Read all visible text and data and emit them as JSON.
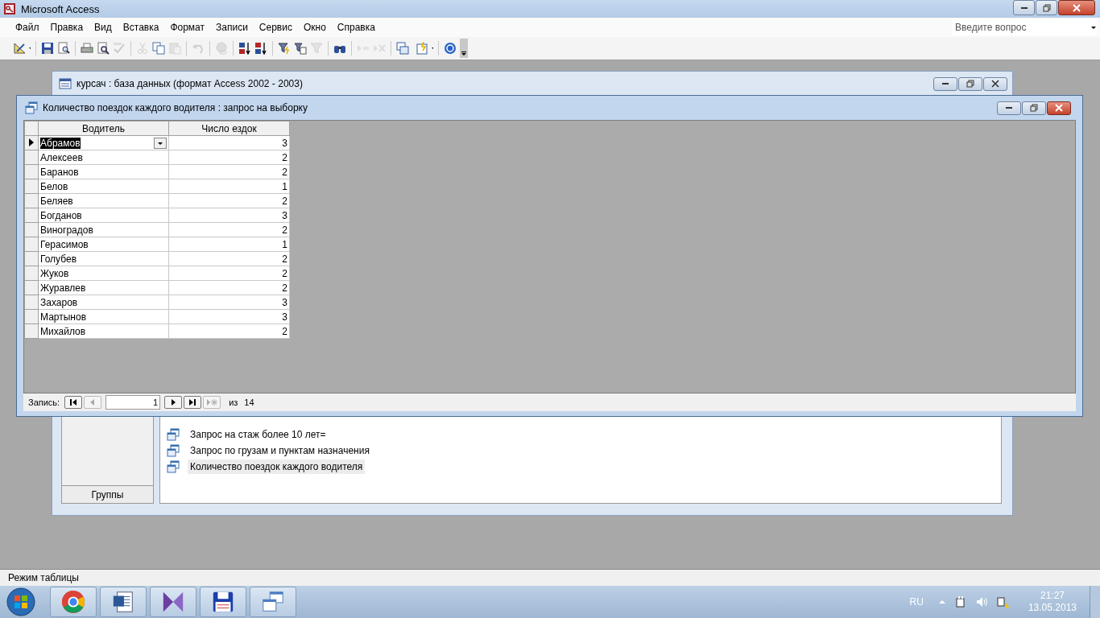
{
  "app": {
    "title": "Microsoft Access",
    "help_search": {
      "placeholder": "Введите вопрос"
    }
  },
  "menu": [
    "Файл",
    "Правка",
    "Вид",
    "Вставка",
    "Формат",
    "Записи",
    "Сервис",
    "Окно",
    "Справка"
  ],
  "toolbar": [
    {
      "kind": "design",
      "disabled": false
    },
    {
      "kind": "separator"
    },
    {
      "kind": "save",
      "disabled": false
    },
    {
      "kind": "file-search",
      "disabled": false
    },
    {
      "kind": "separator"
    },
    {
      "kind": "print",
      "disabled": false
    },
    {
      "kind": "preview",
      "disabled": false
    },
    {
      "kind": "spelling",
      "disabled": true
    },
    {
      "kind": "separator"
    },
    {
      "kind": "cut",
      "disabled": true
    },
    {
      "kind": "copy",
      "disabled": false
    },
    {
      "kind": "paste",
      "disabled": true
    },
    {
      "kind": "separator"
    },
    {
      "kind": "undo",
      "disabled": true
    },
    {
      "kind": "separator"
    },
    {
      "kind": "hyperlink",
      "disabled": true
    },
    {
      "kind": "separator"
    },
    {
      "kind": "sort-asc",
      "disabled": false
    },
    {
      "kind": "sort-desc",
      "disabled": false
    },
    {
      "kind": "separator"
    },
    {
      "kind": "filter-selection",
      "disabled": false
    },
    {
      "kind": "filter-form",
      "disabled": false
    },
    {
      "kind": "filter",
      "disabled": true
    },
    {
      "kind": "separator"
    },
    {
      "kind": "find",
      "disabled": false
    },
    {
      "kind": "separator"
    },
    {
      "kind": "new-record",
      "disabled": true
    },
    {
      "kind": "delete-record",
      "disabled": true
    },
    {
      "kind": "separator"
    },
    {
      "kind": "database-window",
      "disabled": false
    },
    {
      "kind": "new-object",
      "disabled": false
    },
    {
      "kind": "separator"
    },
    {
      "kind": "help",
      "disabled": false
    }
  ],
  "db_window": {
    "title": "курсач : база данных (формат Access 2002 - 2003)",
    "groups_button": "Группы",
    "objects": [
      {
        "label": "Запрос на стаж более 10 лет=",
        "selected": false
      },
      {
        "label": "Запрос по грузам и пунктам назначения",
        "selected": false
      },
      {
        "label": "Количество поездок каждого водителя",
        "selected": true
      }
    ]
  },
  "query_window": {
    "title": "Количество поездок каждого водителя : запрос на выборку",
    "columns": [
      "Водитель",
      "Число ездок"
    ],
    "rows": [
      {
        "driver": "Абрамов",
        "trips": "3",
        "current": true
      },
      {
        "driver": "Алексеев",
        "trips": "2",
        "current": false
      },
      {
        "driver": "Баранов",
        "trips": "2",
        "current": false
      },
      {
        "driver": "Белов",
        "trips": "1",
        "current": false
      },
      {
        "driver": "Беляев",
        "trips": "2",
        "current": false
      },
      {
        "driver": "Богданов",
        "trips": "3",
        "current": false
      },
      {
        "driver": "Виноградов",
        "trips": "2",
        "current": false
      },
      {
        "driver": "Герасимов",
        "trips": "1",
        "current": false
      },
      {
        "driver": "Голубев",
        "trips": "2",
        "current": false
      },
      {
        "driver": "Жуков",
        "trips": "2",
        "current": false
      },
      {
        "driver": "Журавлев",
        "trips": "2",
        "current": false
      },
      {
        "driver": "Захаров",
        "trips": "3",
        "current": false
      },
      {
        "driver": "Мартынов",
        "trips": "3",
        "current": false
      },
      {
        "driver": "Михайлов",
        "trips": "2",
        "current": false
      }
    ],
    "navigation": {
      "label": "Запись:",
      "current": "1",
      "of": "из",
      "total": "14"
    }
  },
  "status_bar": "Режим таблицы",
  "taskbar": {
    "language": "RU",
    "time": "21:27",
    "date": "13.05.2013"
  }
}
